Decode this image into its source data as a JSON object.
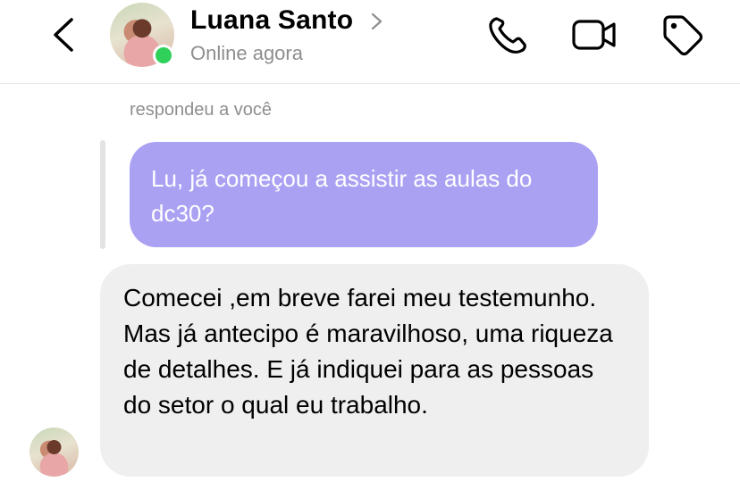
{
  "header": {
    "contact_name": "Luana Santo",
    "status": "Online agora",
    "icons": {
      "back": "chevron-left-icon",
      "name_chevron": "chevron-right-icon",
      "call": "phone-icon",
      "video": "video-camera-icon",
      "tag": "tag-icon"
    },
    "online_color": "#2fd15a"
  },
  "conversation": {
    "reply_label": "respondeu a você",
    "sent_message": "Lu, já começou a assistir as aulas do dc30?",
    "received_message": "Comecei ,em breve farei meu testemunho.  Mas já antecipo é maravilhoso, uma riqueza de detalhes. E já indiquei para as pessoas do setor o qual eu trabalho."
  },
  "colors": {
    "sent_bubble": "#aaa1f3",
    "received_bubble": "#efefef"
  }
}
